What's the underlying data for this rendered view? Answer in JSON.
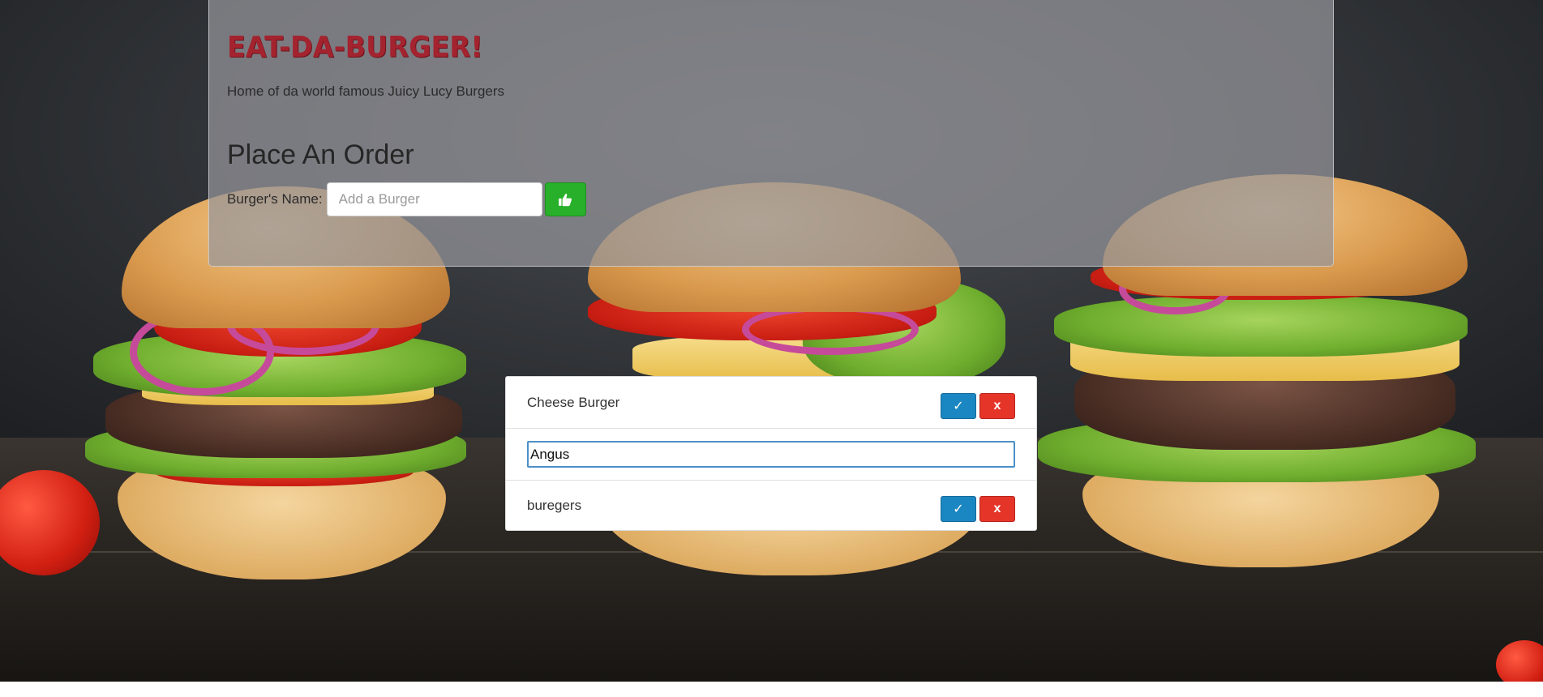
{
  "header": {
    "brand_title": "Eat-Da-Burger!",
    "tagline": "Home of da world famous Juicy Lucy Burgers",
    "order_heading": "Place An Order"
  },
  "order_form": {
    "label": "Burger's Name:",
    "input_placeholder": "Add a Burger",
    "input_value": "",
    "submit_icon": "thumbs-up-icon"
  },
  "burgers": {
    "items": [
      {
        "name": "Cheese Burger",
        "devour_label": "✓",
        "delete_label": "x"
      },
      {
        "name": "Angus",
        "editing": true
      },
      {
        "name": "buregers",
        "devour_label": "✓",
        "delete_label": "x"
      }
    ]
  },
  "colors": {
    "brand_red": "#a3232f",
    "submit_green": "#28b02a",
    "devour_blue": "#1b87c2",
    "delete_red": "#e53529"
  }
}
